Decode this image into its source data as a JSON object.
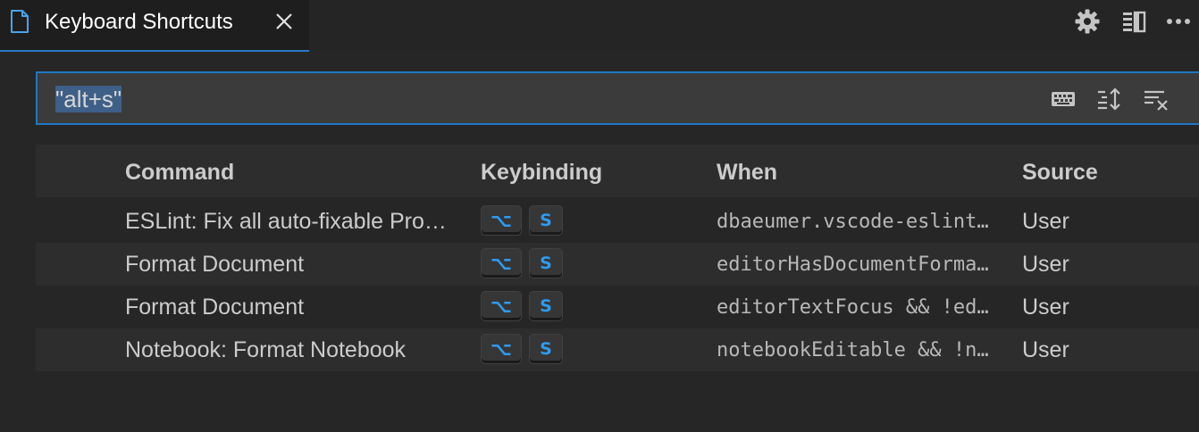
{
  "tab": {
    "label": "Keyboard Shortcuts",
    "icon": "file-icon"
  },
  "actions": [
    {
      "name": "gear-icon"
    },
    {
      "name": "split-editor-icon"
    },
    {
      "name": "more-icon"
    }
  ],
  "search": {
    "value": "\"alt+s\"",
    "icons": [
      "keyboard-icon",
      "sort-by-precedence-icon",
      "clear-search-icon"
    ]
  },
  "table": {
    "headers": {
      "command": "Command",
      "keybinding": "Keybinding",
      "when": "When",
      "source": "Source"
    },
    "rows": [
      {
        "command": "ESLint: Fix all auto-fixable Problems",
        "keys": [
          "⌥",
          "S"
        ],
        "when": "dbaeumer.vscode-eslint.activated",
        "source": "User"
      },
      {
        "command": "Format Document",
        "keys": [
          "⌥",
          "S"
        ],
        "when": "editorHasDocumentFormattingProvider",
        "source": "User"
      },
      {
        "command": "Format Document",
        "keys": [
          "⌥",
          "S"
        ],
        "when": "editorTextFocus && !editorReadonly",
        "source": "User"
      },
      {
        "command": "Notebook: Format Notebook",
        "keys": [
          "⌥",
          "S"
        ],
        "when": "notebookEditable && !notebookCellEditorFocused",
        "source": "User"
      }
    ]
  },
  "colors": {
    "accent": "#2e9bf0",
    "focus_border": "#1f77c4",
    "background": "#262626",
    "selection": "#3e5f87"
  }
}
